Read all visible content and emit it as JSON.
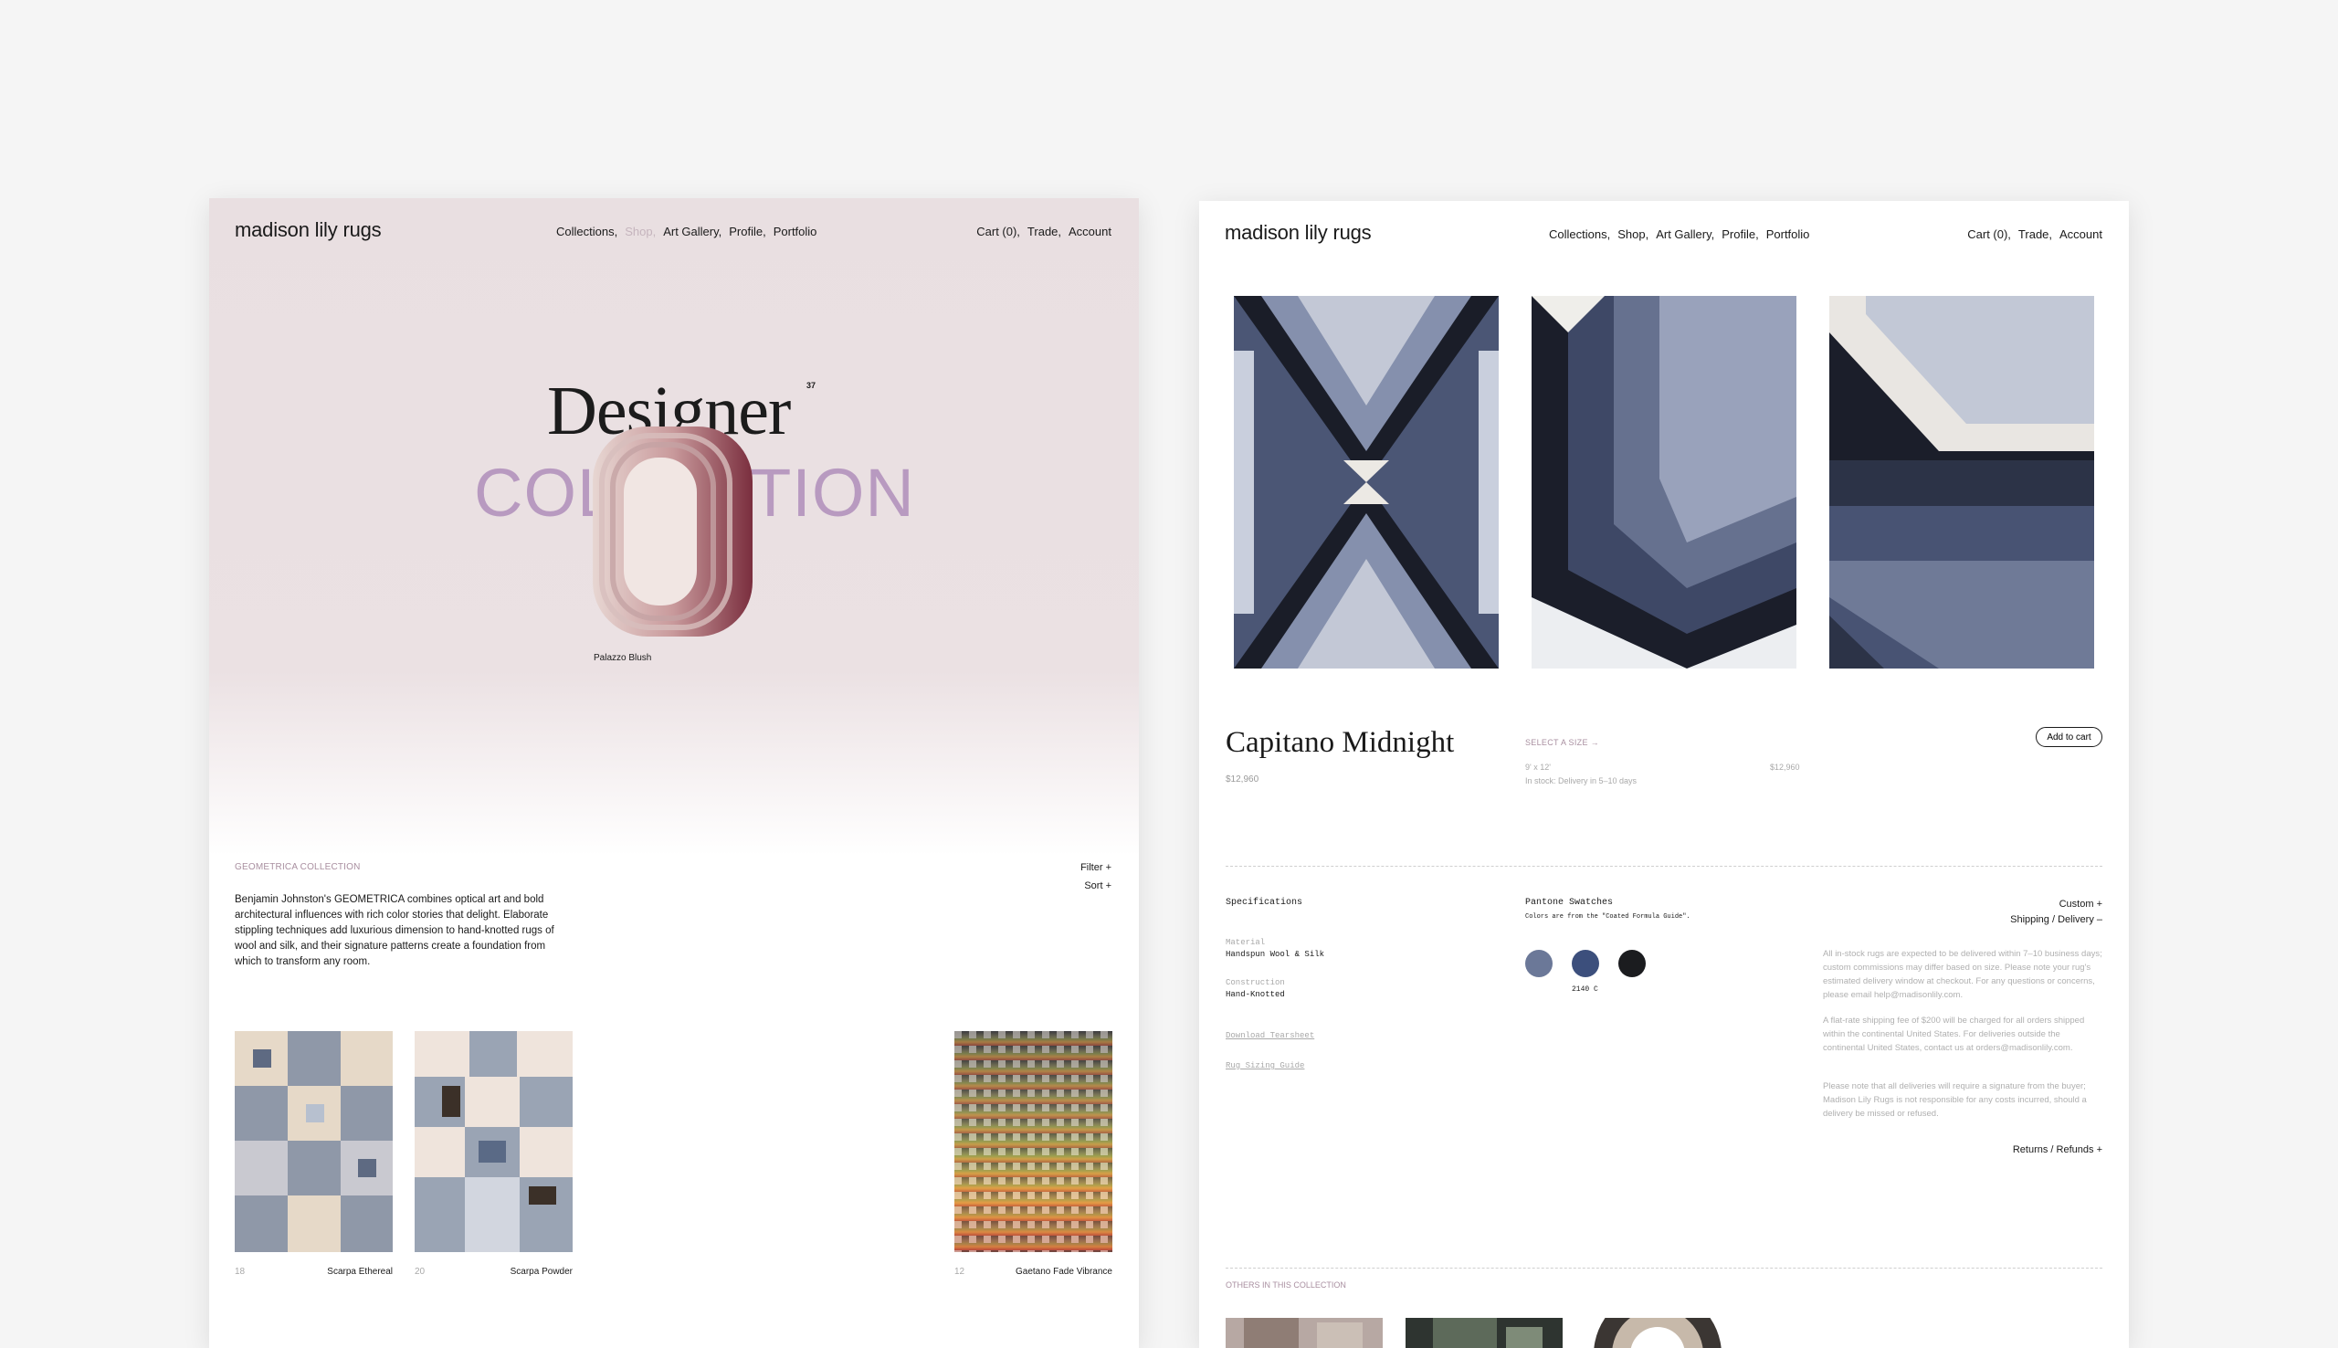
{
  "left": {
    "logo": "madison lily rugs",
    "nav": [
      "Collections,",
      "Shop,",
      "Art Gallery,",
      "Profile,",
      "Portfolio"
    ],
    "nav_right": [
      "Cart (0),",
      "Trade,",
      "Account"
    ],
    "hero": {
      "title": "Designer",
      "superscript": "37",
      "subtitle": "COLLECTION",
      "caption": "Palazzo Blush"
    },
    "collection": {
      "label": "GEOMETRICA COLLECTION",
      "filter": "Filter +",
      "sort": "Sort +",
      "description": "Benjamin Johnston's GEOMETRICA combines optical art and bold architectural influences with rich color stories that delight. Elaborate stippling techniques add luxurious dimension to hand-knotted rugs of wool and silk, and their signature patterns create a foundation from which to transform any room."
    },
    "products": [
      {
        "num": "18",
        "name": "Scarpa Ethereal"
      },
      {
        "num": "20",
        "name": "Scarpa Powder"
      },
      {
        "num": "12",
        "name": "Gaetano Fade Vibrance"
      }
    ]
  },
  "right": {
    "logo": "madison lily rugs",
    "nav": [
      "Collections,",
      "Shop,",
      "Art Gallery,",
      "Profile,",
      "Portfolio"
    ],
    "nav_right": [
      "Cart (0),",
      "Trade,",
      "Account"
    ],
    "product": {
      "title": "Capitano Midnight",
      "price": "$12,960",
      "size_label": "SELECT A SIZE →",
      "size": "9' x 12'",
      "size_price": "$12,960",
      "stock": "In stock: Delivery in 5–10 days",
      "add_to_cart": "Add to cart"
    },
    "specs": {
      "heading": "Specifications",
      "material_label": "Material",
      "material": "Handspun Wool & Silk",
      "construction_label": "Construction",
      "construction": "Hand-Knotted",
      "tearsheet": "Download Tearsheet",
      "sizing": "Rug Sizing Guide"
    },
    "pantone": {
      "heading": "Pantone Swatches",
      "note": "Colors are from the \"Coated Formula Guide\".",
      "code": "2140 C",
      "swatches": [
        "#6b7898",
        "#3c4f7c",
        "#1b1c1f"
      ]
    },
    "shipping": {
      "custom": "Custom +",
      "title": "Shipping / Delivery –",
      "p1": "All in-stock rugs are expected to be delivered within 7–10 business days; custom commissions may differ based on size. Please note your rug's estimated delivery window at checkout. For any questions or concerns, please email help@madisonlily.com.",
      "p2": "A flat-rate shipping fee of $200 will be charged for all orders shipped within the continental United States. For deliveries outside the continental United States, contact us at orders@madisonlily.com.",
      "p3": "Please note that all deliveries will require a signature from the buyer; Madison Lily Rugs is not responsible for any costs incurred, should a delivery be missed or refused.",
      "returns": "Returns / Refunds +"
    },
    "others_label": "OTHERS IN THIS COLLECTION"
  }
}
